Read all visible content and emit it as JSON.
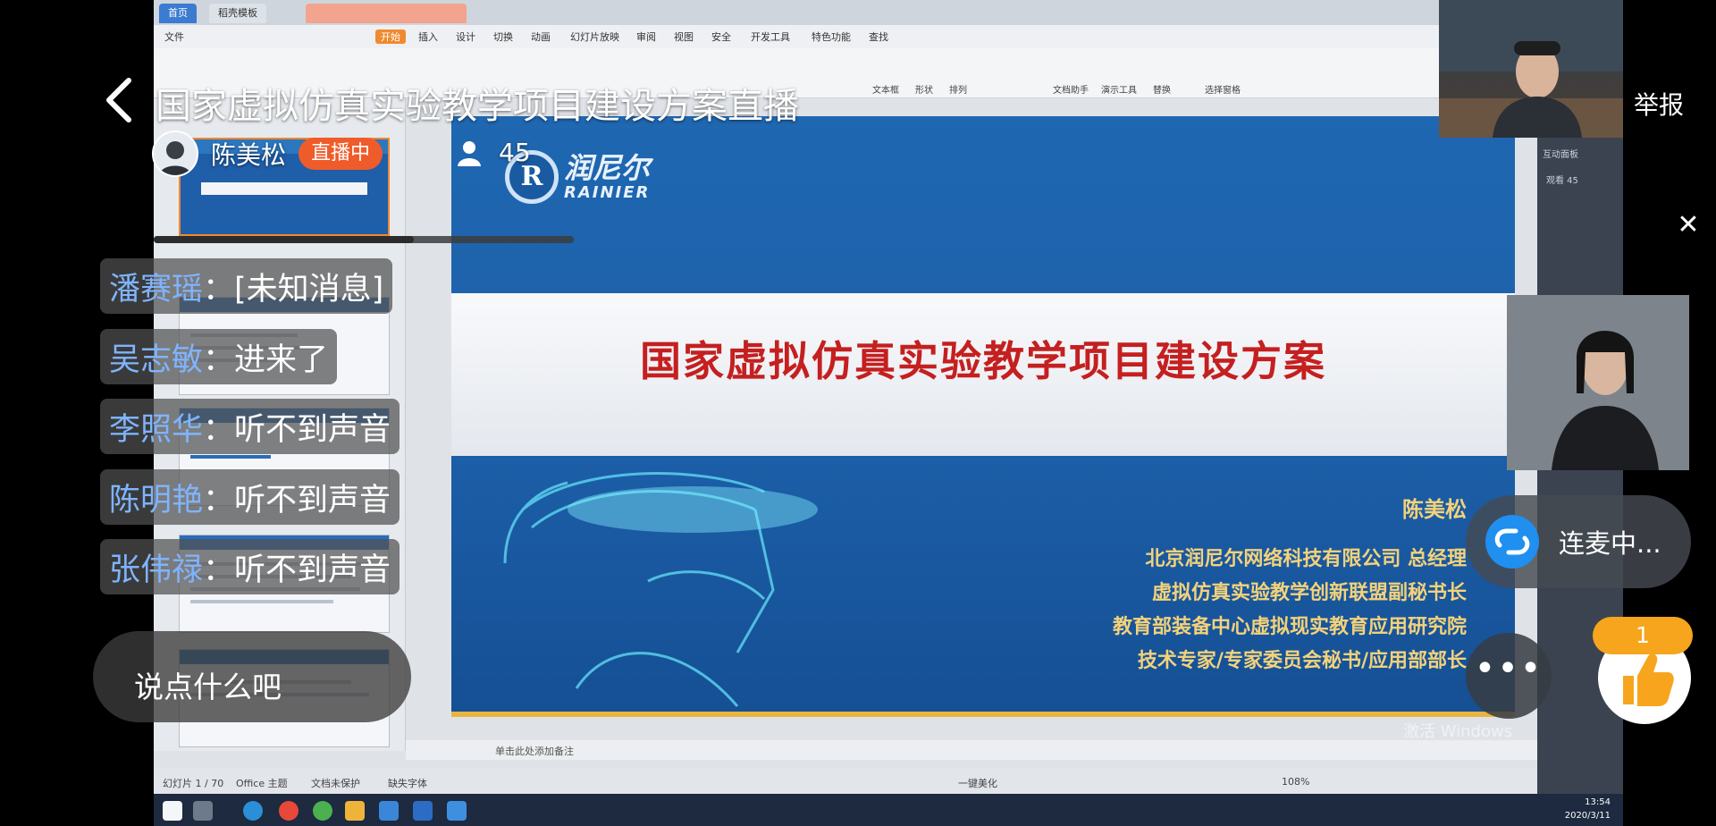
{
  "stream": {
    "title": "国家虚拟仿真实验教学项目建设方案直播",
    "report_label": "举报",
    "host_name": "陈美松",
    "live_badge": "直播中",
    "viewer_count": "45",
    "watch_progress": 0.62
  },
  "chat": [
    {
      "user": "潘赛瑶",
      "text": "：[未知消息]"
    },
    {
      "user": "吴志敏",
      "text": "：进来了"
    },
    {
      "user": "李照华",
      "text": "：听不到声音"
    },
    {
      "user": "陈明艳",
      "text": "：听不到声音"
    },
    {
      "user": "张伟禄",
      "text": "：听不到声音"
    }
  ],
  "comment_placeholder": "说点什么吧",
  "link_mic_label": "连麦中...",
  "likes": "1",
  "colors": {
    "live_badge": "#f05b2a",
    "chat_user": "#7fb4ff",
    "like_badge": "#f7a51d",
    "slide_title": "#c51f1f",
    "slide_bg": "#1f67b1"
  },
  "slide": {
    "brand_cn": "润尼尔",
    "brand_en": "RAINIER",
    "title": "国家虚拟仿真实验教学项目建设方案",
    "presenter": "陈美松",
    "lines": [
      "北京润尼尔网络科技有限公司  总经理",
      "虚拟仿真实验教学创新联盟副秘书长",
      "教育部装备中心虚拟现实教育应用研究院",
      "技术专家/专家委员会秘书/应用部部长"
    ]
  },
  "wps": {
    "tabs": [
      "首页",
      "稻壳模板"
    ],
    "menu": [
      "文件",
      "开始",
      "插入",
      "设计",
      "切换",
      "动画",
      "幻灯片放映",
      "审阅",
      "视图",
      "安全",
      "开发工具",
      "特色功能",
      "查找"
    ],
    "ribbon": [
      "文本框",
      "形状",
      "排列",
      "文档助手",
      "演示工具",
      "替换",
      "选择窗格"
    ],
    "notes_hint": "单击此处添加备注",
    "status": {
      "slide_index": "幻灯片 1 / 70",
      "theme": "Office 主题",
      "protect": "文档未保护",
      "font_missing": "缺失字体",
      "beautify": "一键美化",
      "zoom": "108%"
    },
    "clock_time": "13:54",
    "clock_date": "2020/3/11",
    "activate": "激活 Windows"
  },
  "right_panel": {
    "title": "互动面板",
    "viewers": "观看 45"
  }
}
